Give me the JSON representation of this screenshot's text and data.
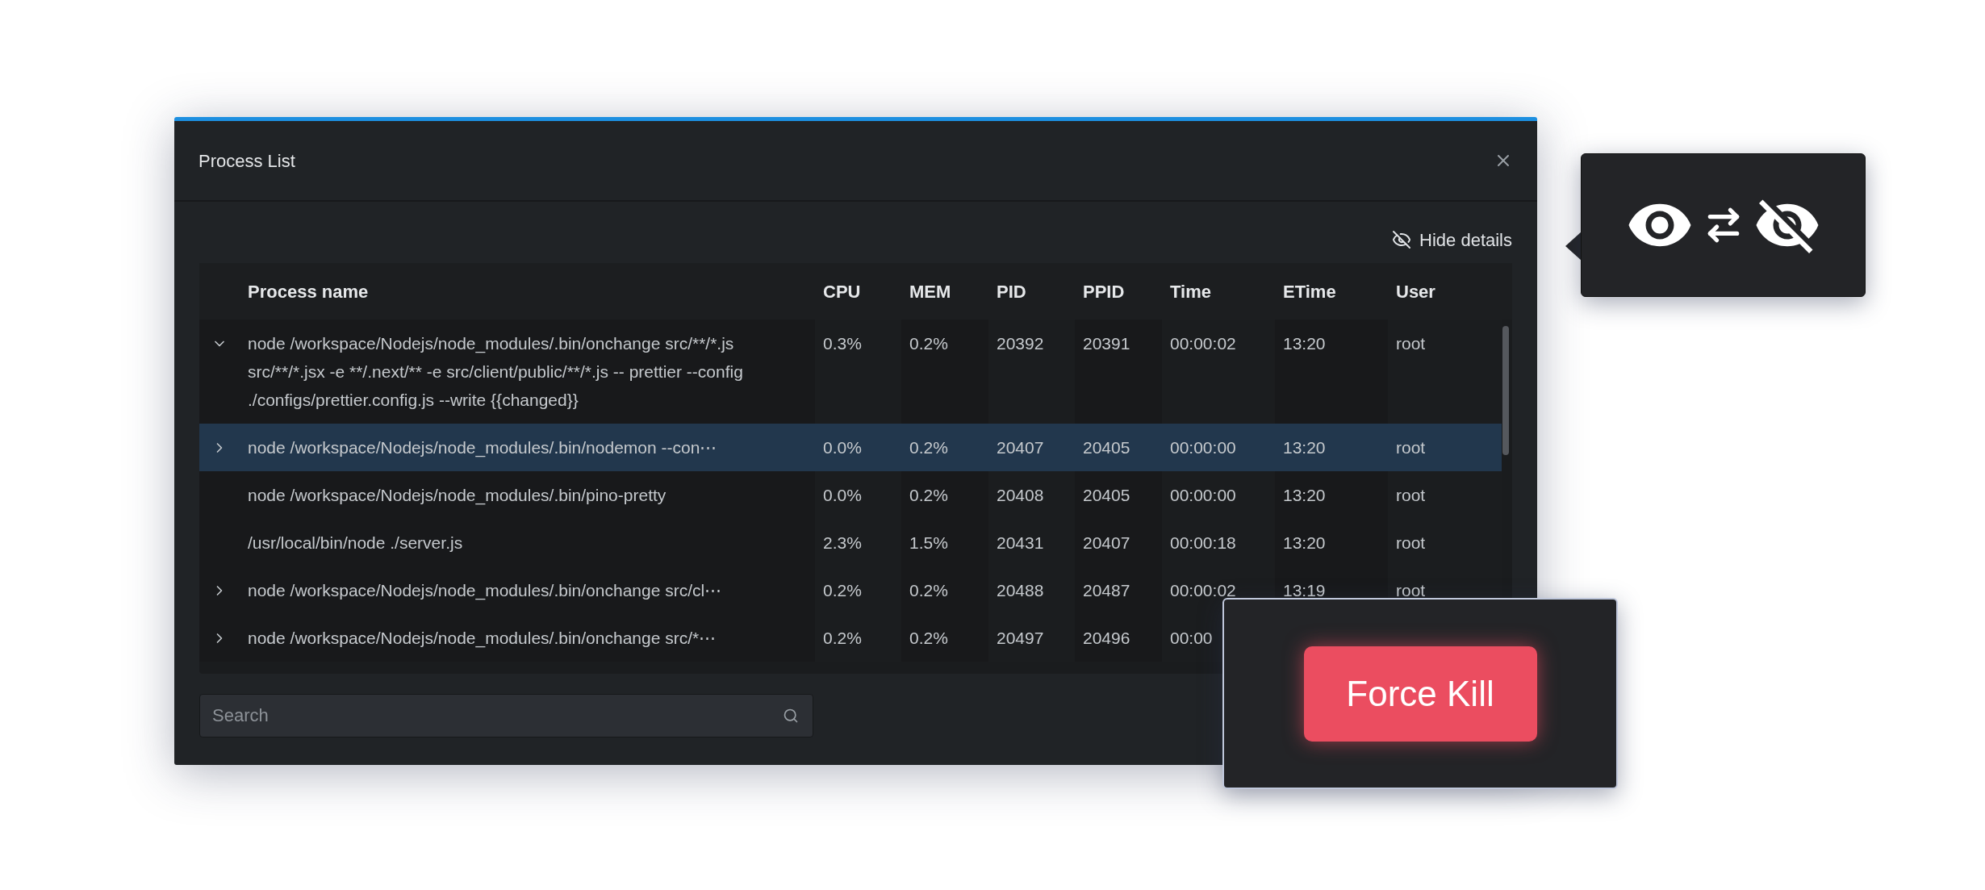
{
  "dialog": {
    "title": "Process List"
  },
  "details_toggle": {
    "label": "Hide details"
  },
  "table": {
    "columns": [
      "Process name",
      "CPU",
      "MEM",
      "PID",
      "PPID",
      "Time",
      "ETime",
      "User"
    ],
    "rows": [
      {
        "kind": "parent",
        "expanded": true,
        "selected": false,
        "cells": [
          "node /workspace/Nodejs/node_modules/.bin/onchange src/**/*.js src/**/*.jsx -e **/.next/** -e src/client/public/**/*.js -- prettier --config ./configs/prettier.config.js --write {{changed}}",
          "0.3%",
          "0.2%",
          "20392",
          "20391",
          "00:00:02",
          "13:20",
          "root"
        ]
      },
      {
        "kind": "parent",
        "expanded": false,
        "selected": true,
        "cells": [
          "node /workspace/Nodejs/node_modules/.bin/nodemon --con⋯",
          "0.0%",
          "0.2%",
          "20407",
          "20405",
          "00:00:00",
          "13:20",
          "root"
        ]
      },
      {
        "kind": "leaf",
        "selected": false,
        "cells": [
          "node /workspace/Nodejs/node_modules/.bin/pino-pretty",
          "0.0%",
          "0.2%",
          "20408",
          "20405",
          "00:00:00",
          "13:20",
          "root"
        ]
      },
      {
        "kind": "leaf",
        "selected": false,
        "cells": [
          "/usr/local/bin/node ./server.js",
          "2.3%",
          "1.5%",
          "20431",
          "20407",
          "00:00:18",
          "13:20",
          "root"
        ]
      },
      {
        "kind": "parent",
        "expanded": false,
        "selected": false,
        "cells": [
          "node /workspace/Nodejs/node_modules/.bin/onchange src/cl⋯",
          "0.2%",
          "0.2%",
          "20488",
          "20487",
          "00:00:02",
          "13:19",
          "root"
        ]
      },
      {
        "kind": "parent",
        "expanded": false,
        "selected": false,
        "cells": [
          "node /workspace/Nodejs/node_modules/.bin/onchange src/*⋯",
          "0.2%",
          "0.2%",
          "20497",
          "20496",
          "00:00"
        ]
      }
    ]
  },
  "search": {
    "placeholder": "Search"
  },
  "force_kill": {
    "label": "Force Kill"
  }
}
